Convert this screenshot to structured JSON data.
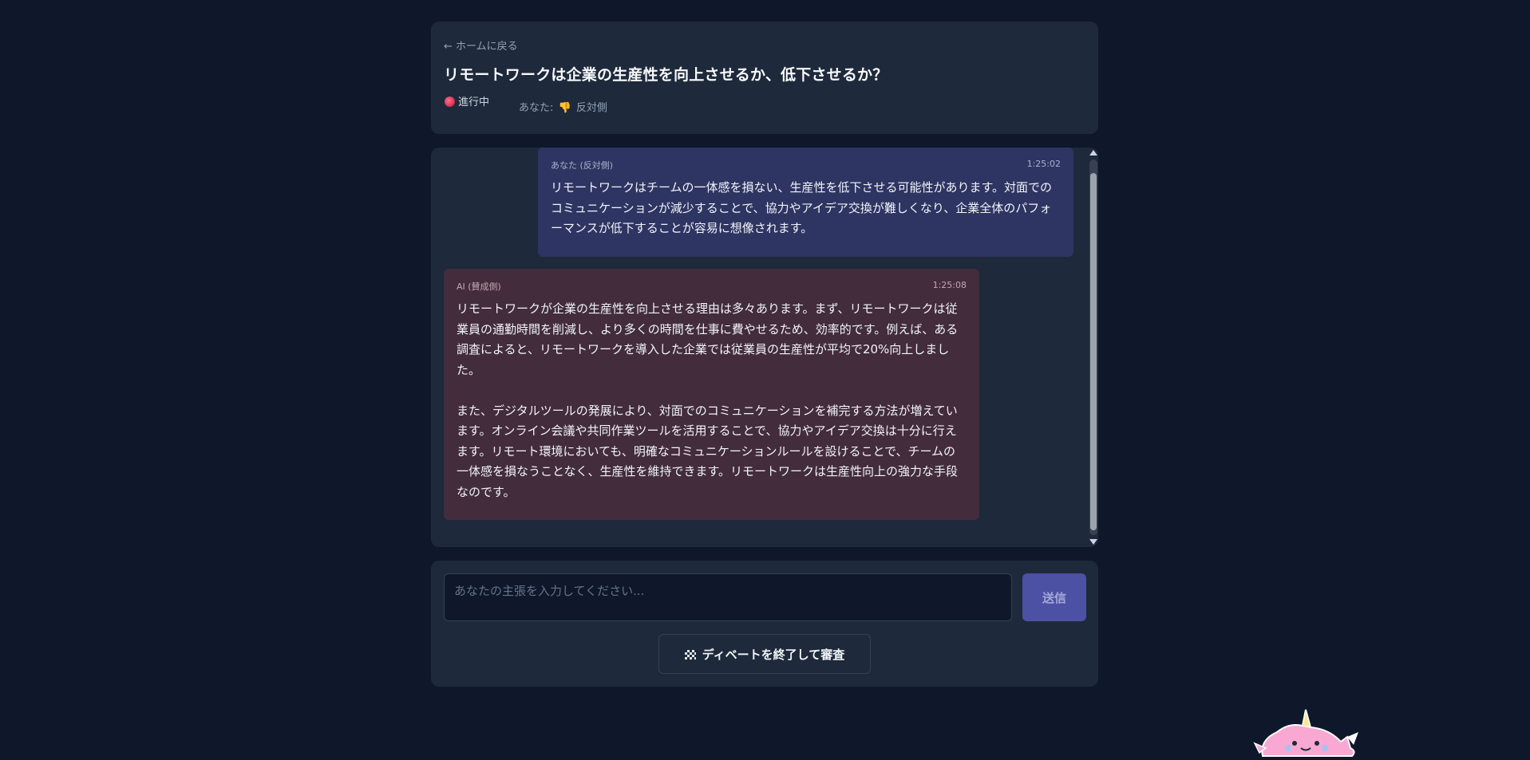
{
  "header": {
    "back_link": "← ホームに戻る",
    "title": "リモートワークは企業の生産性を向上させるか、低下させるか？",
    "status": "進行中",
    "you_label": "あなた:",
    "you_side": "反対側"
  },
  "messages": [
    {
      "role": "user",
      "author": "あなた (反対側)",
      "time": "1:25:02",
      "text": "リモートワークはチームの一体感を損ない、生産性を低下させる可能性があります。対面でのコミュニケーションが減少することで、協力やアイデア交換が難しくなり、企業全体のパフォーマンスが低下することが容易に想像されます。"
    },
    {
      "role": "ai",
      "author": "AI (賛成側)",
      "time": "1:25:08",
      "text": "リモートワークが企業の生産性を向上させる理由は多々あります。まず、リモートワークは従業員の通勤時間を削減し、より多くの時間を仕事に費やせるため、効率的です。例えば、ある調査によると、リモートワークを導入した企業では従業員の生産性が平均で20%向上しました。\n\nまた、デジタルツールの発展により、対面でのコミュニケーションを補完する方法が増えています。オンライン会議や共同作業ツールを活用することで、協力やアイデア交換は十分に行えます。リモート環境においても、明確なコミュニケーションルールを設けることで、チームの一体感を損なうことなく、生産性を維持できます。リモートワークは生産性向上の強力な手段なのです。"
    }
  ],
  "composer": {
    "placeholder": "あなたの主張を入力してください...",
    "value": "",
    "send_label": "送信",
    "finish_label": "ディベートを終了して審査"
  },
  "icons": {
    "status": "red-dot-icon",
    "side": "thumbs-down-icon",
    "finish": "checkered-flag-icon",
    "mascot": "unicorn-mascot"
  }
}
